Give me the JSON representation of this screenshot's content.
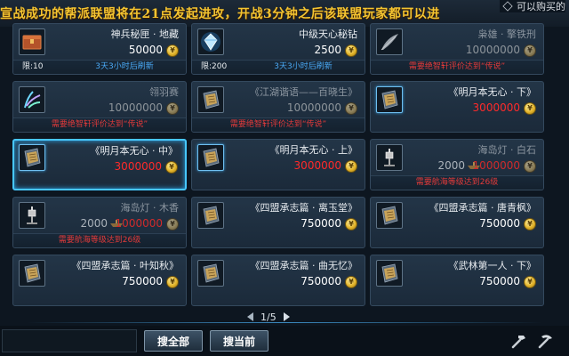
{
  "banner": {
    "text": "宣战成功的帮派联盟将在21点发起进攻，开战3分钟之后该联盟玩家都可以进"
  },
  "filter": {
    "label": "可以购买的"
  },
  "items": [
    {
      "name": "神兵秘匣 · 地藏",
      "price": "50000",
      "price_style": "white",
      "icon": "box-icon",
      "status": "limit",
      "limit": "限:10",
      "refresh": "3天3小时后刷新"
    },
    {
      "name": "中级天心秘钻",
      "price": "2500",
      "price_style": "white",
      "icon": "gem-icon",
      "status": "limit",
      "limit": "限:200",
      "refresh": "3天3小时后刷新"
    },
    {
      "name": "枭雄 · 擎铁刑",
      "price": "10000000",
      "price_style": "gray",
      "icon": "feather-icon",
      "status": "require",
      "require": "需要绝智轩评价达到“传说”",
      "dim": true
    },
    {
      "name": "翎羽赛",
      "price": "10000000",
      "price_style": "gray",
      "icon": "plume-icon",
      "status": "require",
      "require": "需要绝智轩评价达到“传说”",
      "dim": true
    },
    {
      "name": "《江湖谐语——百晓生》",
      "price": "10000000",
      "price_style": "gray",
      "icon": "book-icon",
      "status": "require",
      "require": "需要绝智轩评价达到“传说”",
      "dim": true
    },
    {
      "name": "《明月本无心 · 下》",
      "price": "3000000",
      "price_style": "red",
      "icon": "book-icon",
      "framed": true
    },
    {
      "name": "《明月本无心 · 中》",
      "price": "3000000",
      "price_style": "red",
      "icon": "book-icon",
      "framed": true,
      "selected": true
    },
    {
      "name": "《明月本无心 · 上》",
      "price": "3000000",
      "price_style": "red",
      "icon": "book-icon",
      "framed": true
    },
    {
      "name": "海岛灯 · 白石",
      "price": "2000",
      "offer": "1000000",
      "price_style": "gray",
      "icon": "lantern-icon",
      "status": "require",
      "require": "需要航海等级达到26级",
      "dim": true
    },
    {
      "name": "海岛灯 · 木香",
      "price": "2000",
      "offer": "1000000",
      "price_style": "gray",
      "icon": "lantern-icon",
      "status": "require",
      "require": "需要航海等级达到26级",
      "dim": true
    },
    {
      "name": "《四盟承志篇 · 离玉堂》",
      "price": "750000",
      "price_style": "white",
      "icon": "book-icon"
    },
    {
      "name": "《四盟承志篇 · 唐青枫》",
      "price": "750000",
      "price_style": "white",
      "icon": "book-icon"
    },
    {
      "name": "《四盟承志篇 · 叶知秋》",
      "price": "750000",
      "price_style": "white",
      "icon": "book-icon"
    },
    {
      "name": "《四盟承志篇 · 曲无忆》",
      "price": "750000",
      "price_style": "white",
      "icon": "book-icon"
    },
    {
      "name": "《武林第一人 · 下》",
      "price": "750000",
      "price_style": "white",
      "icon": "book-icon"
    }
  ],
  "pager": {
    "page": "1/5"
  },
  "search": {
    "value": ""
  },
  "buttons": {
    "search_all": "搜全部",
    "search_current": "搜当前"
  },
  "colors": {
    "accent": "#47c7ff",
    "price_red": "#ff2a2a",
    "refresh_blue": "#4aa9f5",
    "require_red": "#e23a3a",
    "banner_gold": "#f3c431"
  }
}
